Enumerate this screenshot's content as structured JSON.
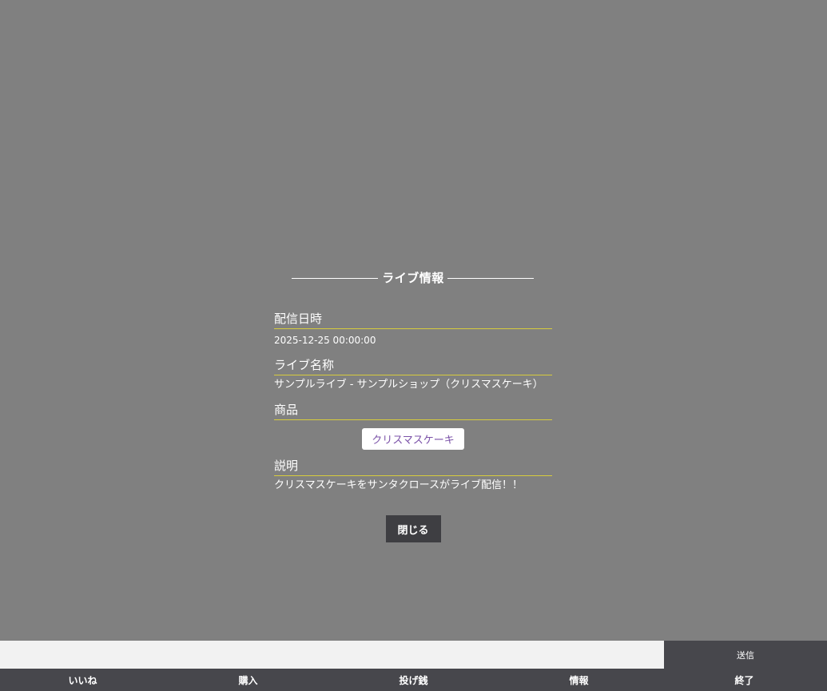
{
  "modal": {
    "title": "ライブ情報",
    "sections": {
      "datetime": {
        "heading": "配信日時",
        "value": "2025-12-25 00:00:00"
      },
      "name": {
        "heading": "ライブ名称",
        "value": "サンプルライブ - サンプルショップ（クリスマスケーキ）"
      },
      "product": {
        "heading": "商品",
        "button_label": "クリスマスケーキ"
      },
      "description": {
        "heading": "説明",
        "value": "クリスマスケーキをサンタクロースがライブ配信！！"
      }
    },
    "close_label": "閉じる"
  },
  "comment": {
    "input_value": "",
    "placeholder": "",
    "send_label": "送信"
  },
  "nav": {
    "items": [
      {
        "label": "いいね"
      },
      {
        "label": "購入"
      },
      {
        "label": "投げ銭"
      },
      {
        "label": "情報"
      },
      {
        "label": "終了"
      }
    ]
  },
  "colors": {
    "background": "#808080",
    "heading_underline": "#d7cc3c",
    "product_text": "#7b52a8",
    "dark_button": "#3e3e42",
    "nav_bar": "#47474c"
  }
}
